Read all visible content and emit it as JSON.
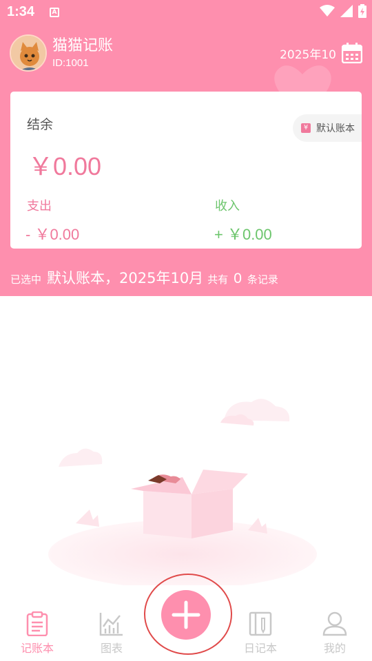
{
  "status_bar": {
    "time": "1:34",
    "notification_badge": "A",
    "icons": [
      "wifi-icon",
      "signal-icon",
      "battery-icon"
    ]
  },
  "profile": {
    "app_name": "猫猫记账",
    "user_id": "ID:1001"
  },
  "month_picker": {
    "label": "2025年10",
    "icon": "calendar-icon"
  },
  "card": {
    "balance_label": "结余",
    "balance_value": "￥0.00",
    "book_tag": "默认账本",
    "expense_label": "支出",
    "expense_value": "- ￥0.00",
    "income_label": "收入",
    "income_value": "+ ￥0.00"
  },
  "summary": {
    "prefix": "已选中",
    "book_period": "默认账本，2025年10月",
    "middle": "共有",
    "count": "0",
    "suffix": "条记录"
  },
  "tabbar": {
    "tabs": [
      {
        "label": "记账本",
        "icon": "clipboard-icon",
        "active": true
      },
      {
        "label": "图表",
        "icon": "chart-icon",
        "active": false
      },
      {
        "label": "日记本",
        "icon": "notebook-icon",
        "active": false
      },
      {
        "label": "我的",
        "icon": "person-icon",
        "active": false
      }
    ],
    "add_icon": "plus-icon"
  },
  "colors": {
    "primary": "#fe8fae",
    "expense": "#f0799c",
    "income": "#6cc56c",
    "inactive": "#c8c8c8"
  }
}
